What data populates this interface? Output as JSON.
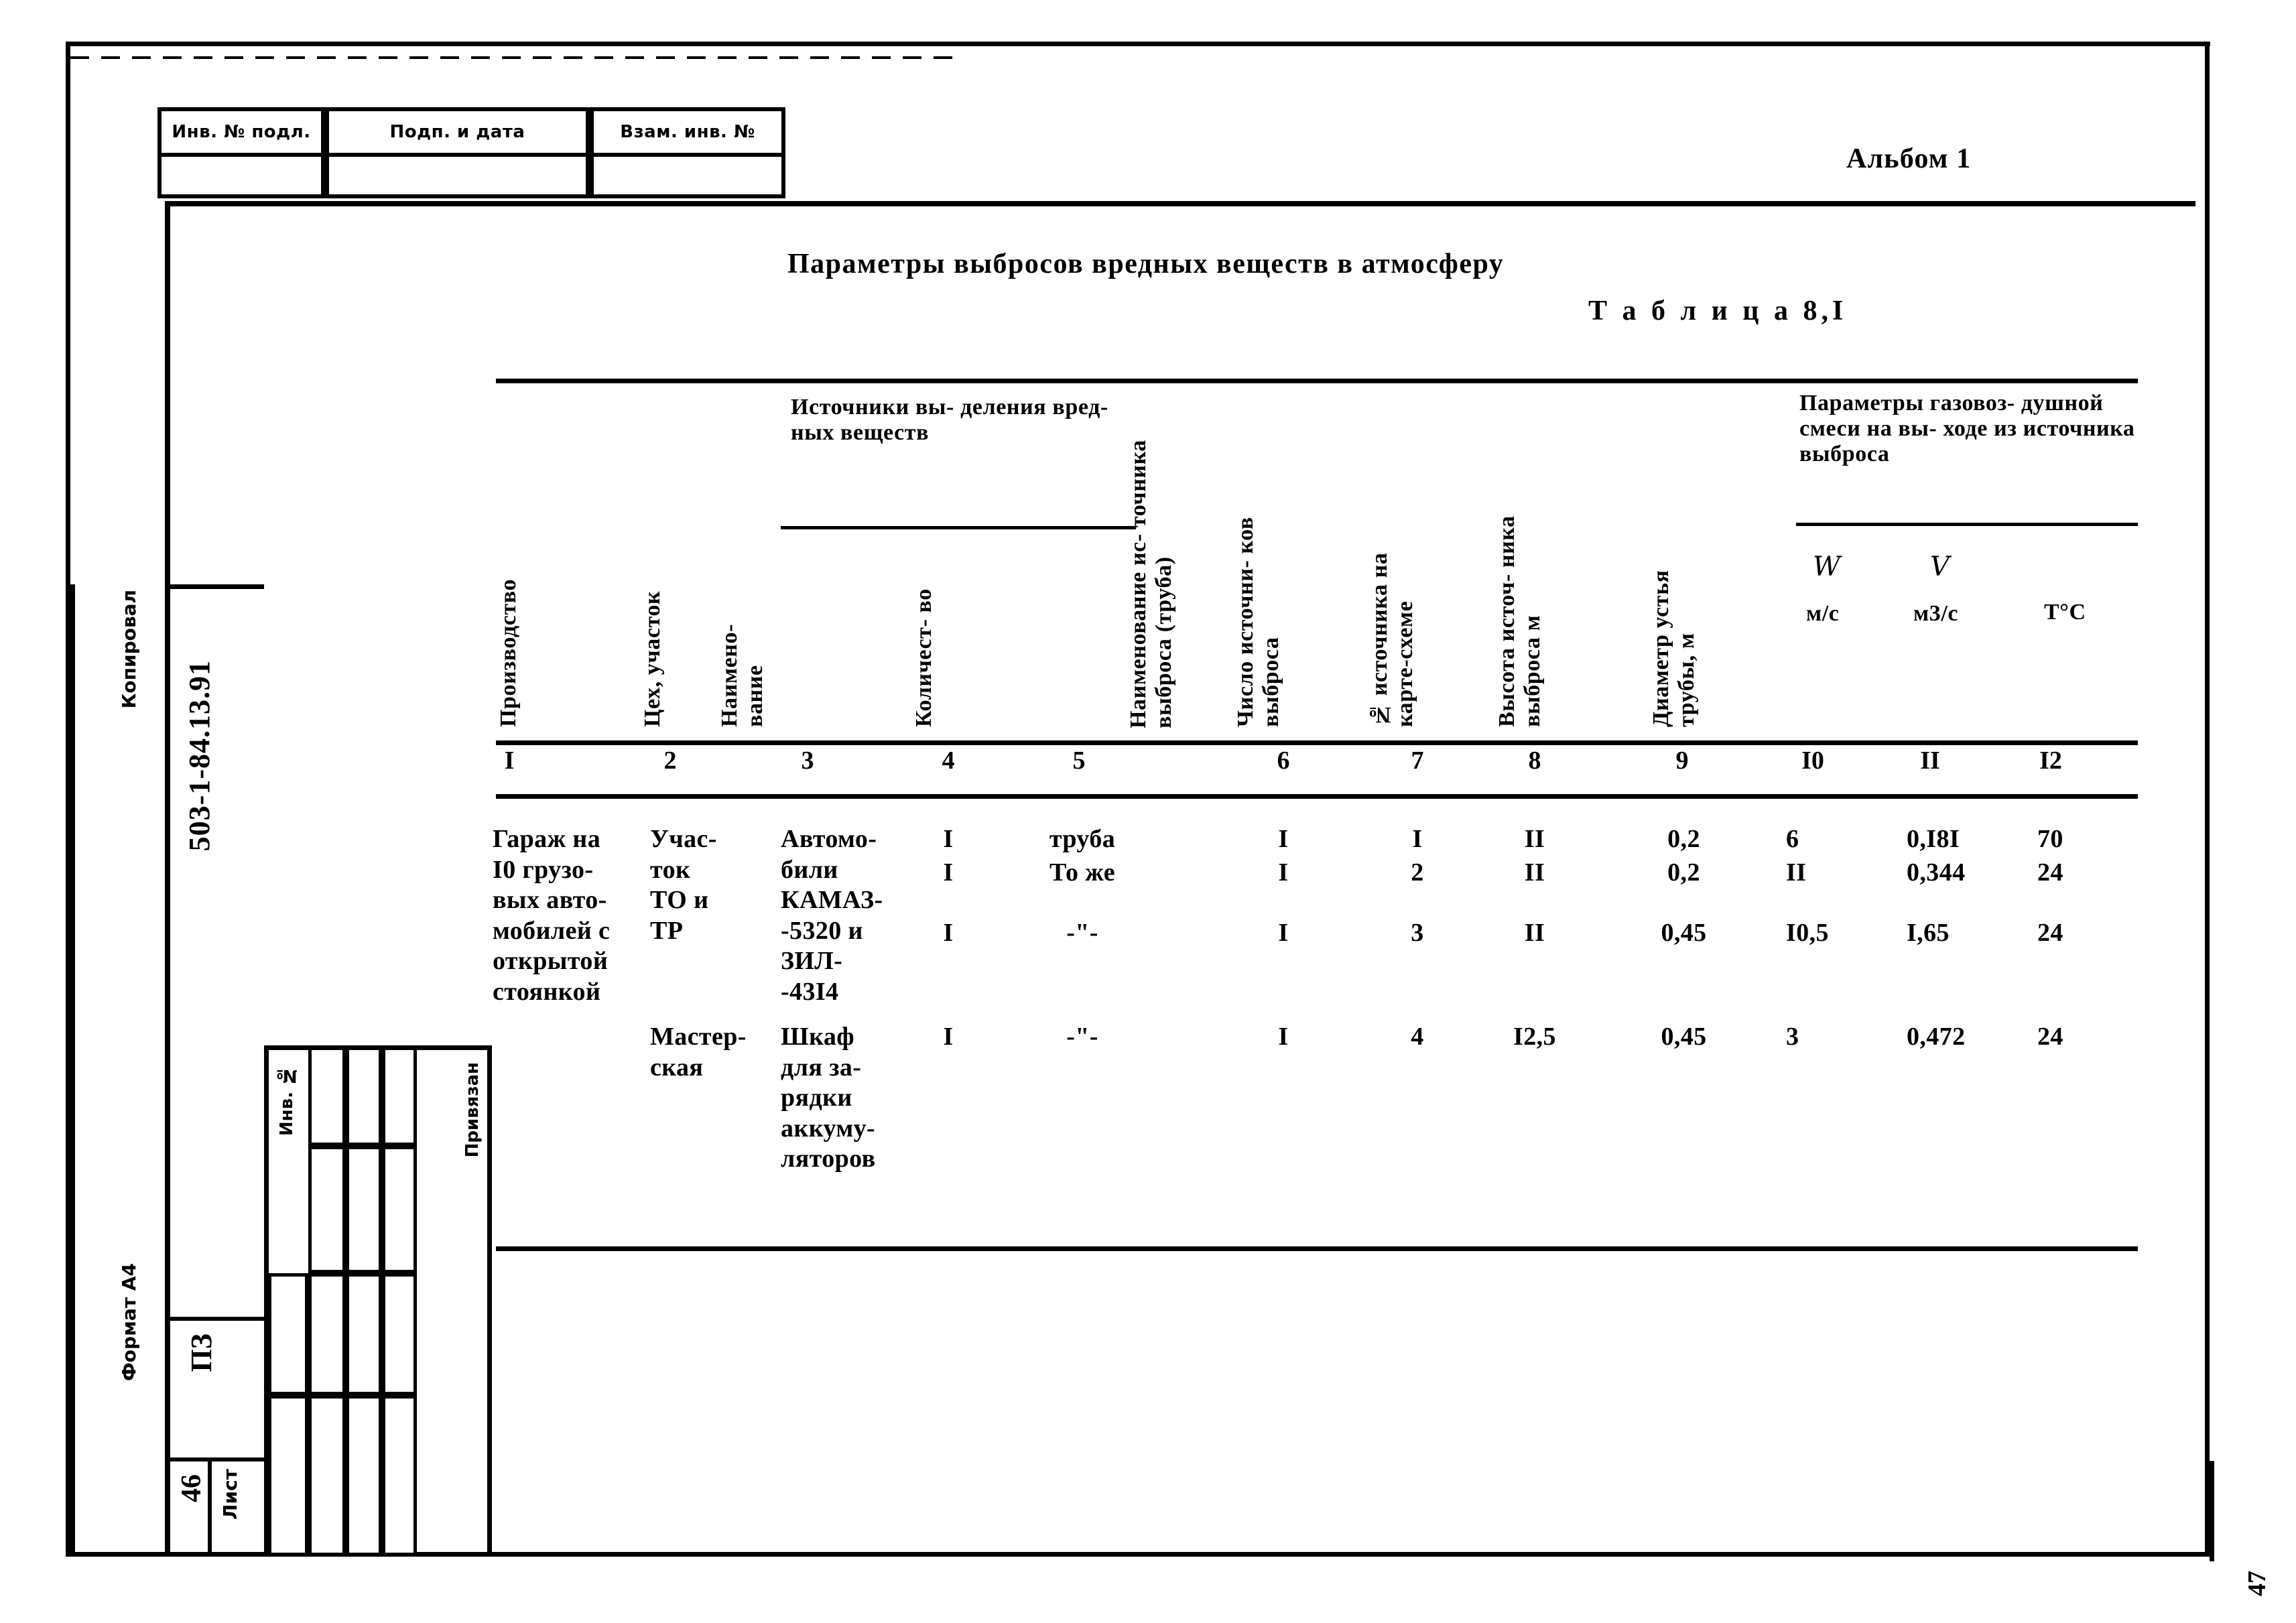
{
  "page": {
    "album": "Альбом 1",
    "sheet_number_right": "47",
    "format_label": "Формат А4",
    "copier_label": "Копировал",
    "doc_code": "503-1-84.13.91",
    "doc_stage": "ПЗ",
    "sheet_no": "46",
    "sheet_word": "Лист",
    "inv_no_label": "Инв. №",
    "binding_label": "Привязан"
  },
  "top_stamps": [
    {
      "label": "Инв. № подл."
    },
    {
      "label": "Подп. и дата"
    },
    {
      "label": "Взам. инв. №"
    }
  ],
  "table": {
    "title": "Параметры выбросов вредных веществ в атмосферу",
    "caption": "Т а б л и ц а   8,I",
    "group_headers": [
      {
        "label": "Источники вы-\nделения вред-\nных веществ"
      },
      {
        "label": "Параметры газовоз-\nдушной смеси на вы-\nходе из источника\nвыброса"
      }
    ],
    "headers": [
      {
        "id": "proizvodstvo",
        "label": "Производство",
        "rotated": true
      },
      {
        "id": "tseh",
        "label": "Цех, участок",
        "rotated": true
      },
      {
        "id": "naimenovanie",
        "label": "Наимено-\nвание",
        "rotated": true
      },
      {
        "id": "kolichestvo",
        "label": "Количест-\nво",
        "rotated": true
      },
      {
        "id": "istochnik",
        "label": "Наименование ис-\nточника выброса\n(труба)",
        "rotated": true
      },
      {
        "id": "chislo",
        "label": "Число источни-\nков выброса",
        "rotated": true
      },
      {
        "id": "nomer",
        "label": "№ источника на\nкарте-схеме",
        "rotated": true
      },
      {
        "id": "vysota",
        "label": "Высота источ-\nника выброса\nм",
        "rotated": true
      },
      {
        "id": "diametr",
        "label": "Диаметр устья\nтрубы, м",
        "rotated": true
      },
      {
        "id": "w",
        "label": "м/с",
        "symbol": "W",
        "rotated": false
      },
      {
        "id": "v",
        "label": "м3/с",
        "symbol": "V",
        "rotated": false
      },
      {
        "id": "t",
        "label": "Т°С",
        "rotated": false
      }
    ],
    "column_numbers": [
      "I",
      "2",
      "3",
      "4",
      "5",
      "6",
      "7",
      "8",
      "9",
      "I0",
      "II",
      "I2"
    ],
    "rows": [
      {
        "production": "Гараж на\nI0 грузо-\nвых авто-\nмобилей с\nоткрытой\nстоянкой",
        "shop": "Учас-\nток\nТО и\nТР",
        "source_name": "Автомо-\nбили\nКАМАЗ-\n-5320 и\nЗИЛ-\n-43I4",
        "lines": [
          {
            "qty": "I",
            "emitter": "труба",
            "count": "I",
            "map_no": "I",
            "height": "II",
            "diameter": "0,2",
            "w": "6",
            "v": "0,I8I",
            "t": "70"
          },
          {
            "qty": "I",
            "emitter": "То же",
            "count": "I",
            "map_no": "2",
            "height": "II",
            "diameter": "0,2",
            "w": "II",
            "v": "0,344",
            "t": "24"
          },
          {
            "qty": "I",
            "emitter": "-\"-",
            "count": "I",
            "map_no": "3",
            "height": "II",
            "diameter": "0,45",
            "w": "I0,5",
            "v": "I,65",
            "t": "24"
          }
        ]
      },
      {
        "production": "",
        "shop": "Мастер-\nская",
        "source_name": "Шкаф\nдля за-\nрядки\nаккуму-\nляторов",
        "lines": [
          {
            "qty": "I",
            "emitter": "-\"-",
            "count": "I",
            "map_no": "4",
            "height": "I2,5",
            "diameter": "0,45",
            "w": "3",
            "v": "0,472",
            "t": "24"
          }
        ]
      }
    ]
  }
}
